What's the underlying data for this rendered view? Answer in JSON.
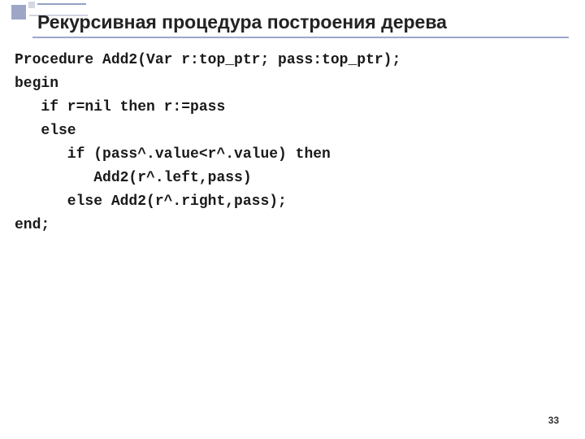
{
  "slide": {
    "title": "Рекурсивная процедура построения дерева",
    "page_number": "33"
  },
  "code": {
    "line1": "Procedure Add2(Var r:top_ptr; pass:top_ptr);",
    "line2": "begin",
    "line3": "   if r=nil then r:=pass",
    "line4": "   else",
    "line5": "      if (pass^.value<r^.value) then",
    "line6": "         Add2(r^.left,pass)",
    "line7": "      else Add2(r^.right,pass);",
    "line8": "end;"
  }
}
